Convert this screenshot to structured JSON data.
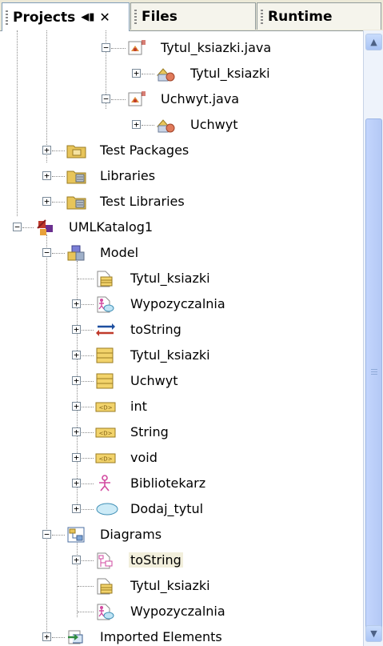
{
  "tabs": [
    {
      "label": "Projects",
      "active": true,
      "controls": "◀▮",
      "close": "✕"
    },
    {
      "label": "Files"
    },
    {
      "label": "Runtime"
    }
  ],
  "tree": [
    {
      "label": "Tytul_ksiazki.java",
      "icon": "java-form-icon"
    },
    {
      "label": "Tytul_ksiazki",
      "icon": "class-icon"
    },
    {
      "label": "Uchwyt.java",
      "icon": "java-form-icon"
    },
    {
      "label": "Uchwyt",
      "icon": "class-icon"
    },
    {
      "label": "Test Packages",
      "icon": "package-folder-icon"
    },
    {
      "label": "Libraries",
      "icon": "library-folder-icon"
    },
    {
      "label": "Test Libraries",
      "icon": "library-folder-icon"
    },
    {
      "label": "UMLKatalog1",
      "icon": "uml-project-icon"
    },
    {
      "label": "Model",
      "icon": "model-icon"
    },
    {
      "label": "Tytul_ksiazki",
      "icon": "class-diagram-icon"
    },
    {
      "label": "Wypozyczalnia",
      "icon": "use-case-diagram-icon"
    },
    {
      "label": "toString",
      "icon": "operation-arrows-icon"
    },
    {
      "label": "Tytul_ksiazki",
      "icon": "uml-class-icon"
    },
    {
      "label": "Uchwyt",
      "icon": "uml-class-icon"
    },
    {
      "label": "int",
      "icon": "datatype-icon",
      "badge": "<D>"
    },
    {
      "label": "String",
      "icon": "datatype-icon",
      "badge": "<D>"
    },
    {
      "label": "void",
      "icon": "datatype-icon",
      "badge": "<D>"
    },
    {
      "label": "Bibliotekarz",
      "icon": "actor-icon"
    },
    {
      "label": "Dodaj_tytul",
      "icon": "use-case-icon"
    },
    {
      "label": "Diagrams",
      "icon": "diagrams-folder-icon"
    },
    {
      "label": "toString",
      "icon": "sequence-diagram-icon",
      "selected": true
    },
    {
      "label": "Tytul_ksiazki",
      "icon": "class-diagram-icon"
    },
    {
      "label": "Wypozyczalnia",
      "icon": "use-case-diagram-icon"
    },
    {
      "label": "Imported Elements",
      "icon": "imported-elements-icon"
    }
  ],
  "scrollbar": {
    "up": "▲",
    "down": "▼"
  },
  "colors": {
    "folder": "#e8c55a",
    "accent": "#c03a2b",
    "selection": "#f2efdc",
    "scroll_thumb": "#b4c9f5"
  }
}
